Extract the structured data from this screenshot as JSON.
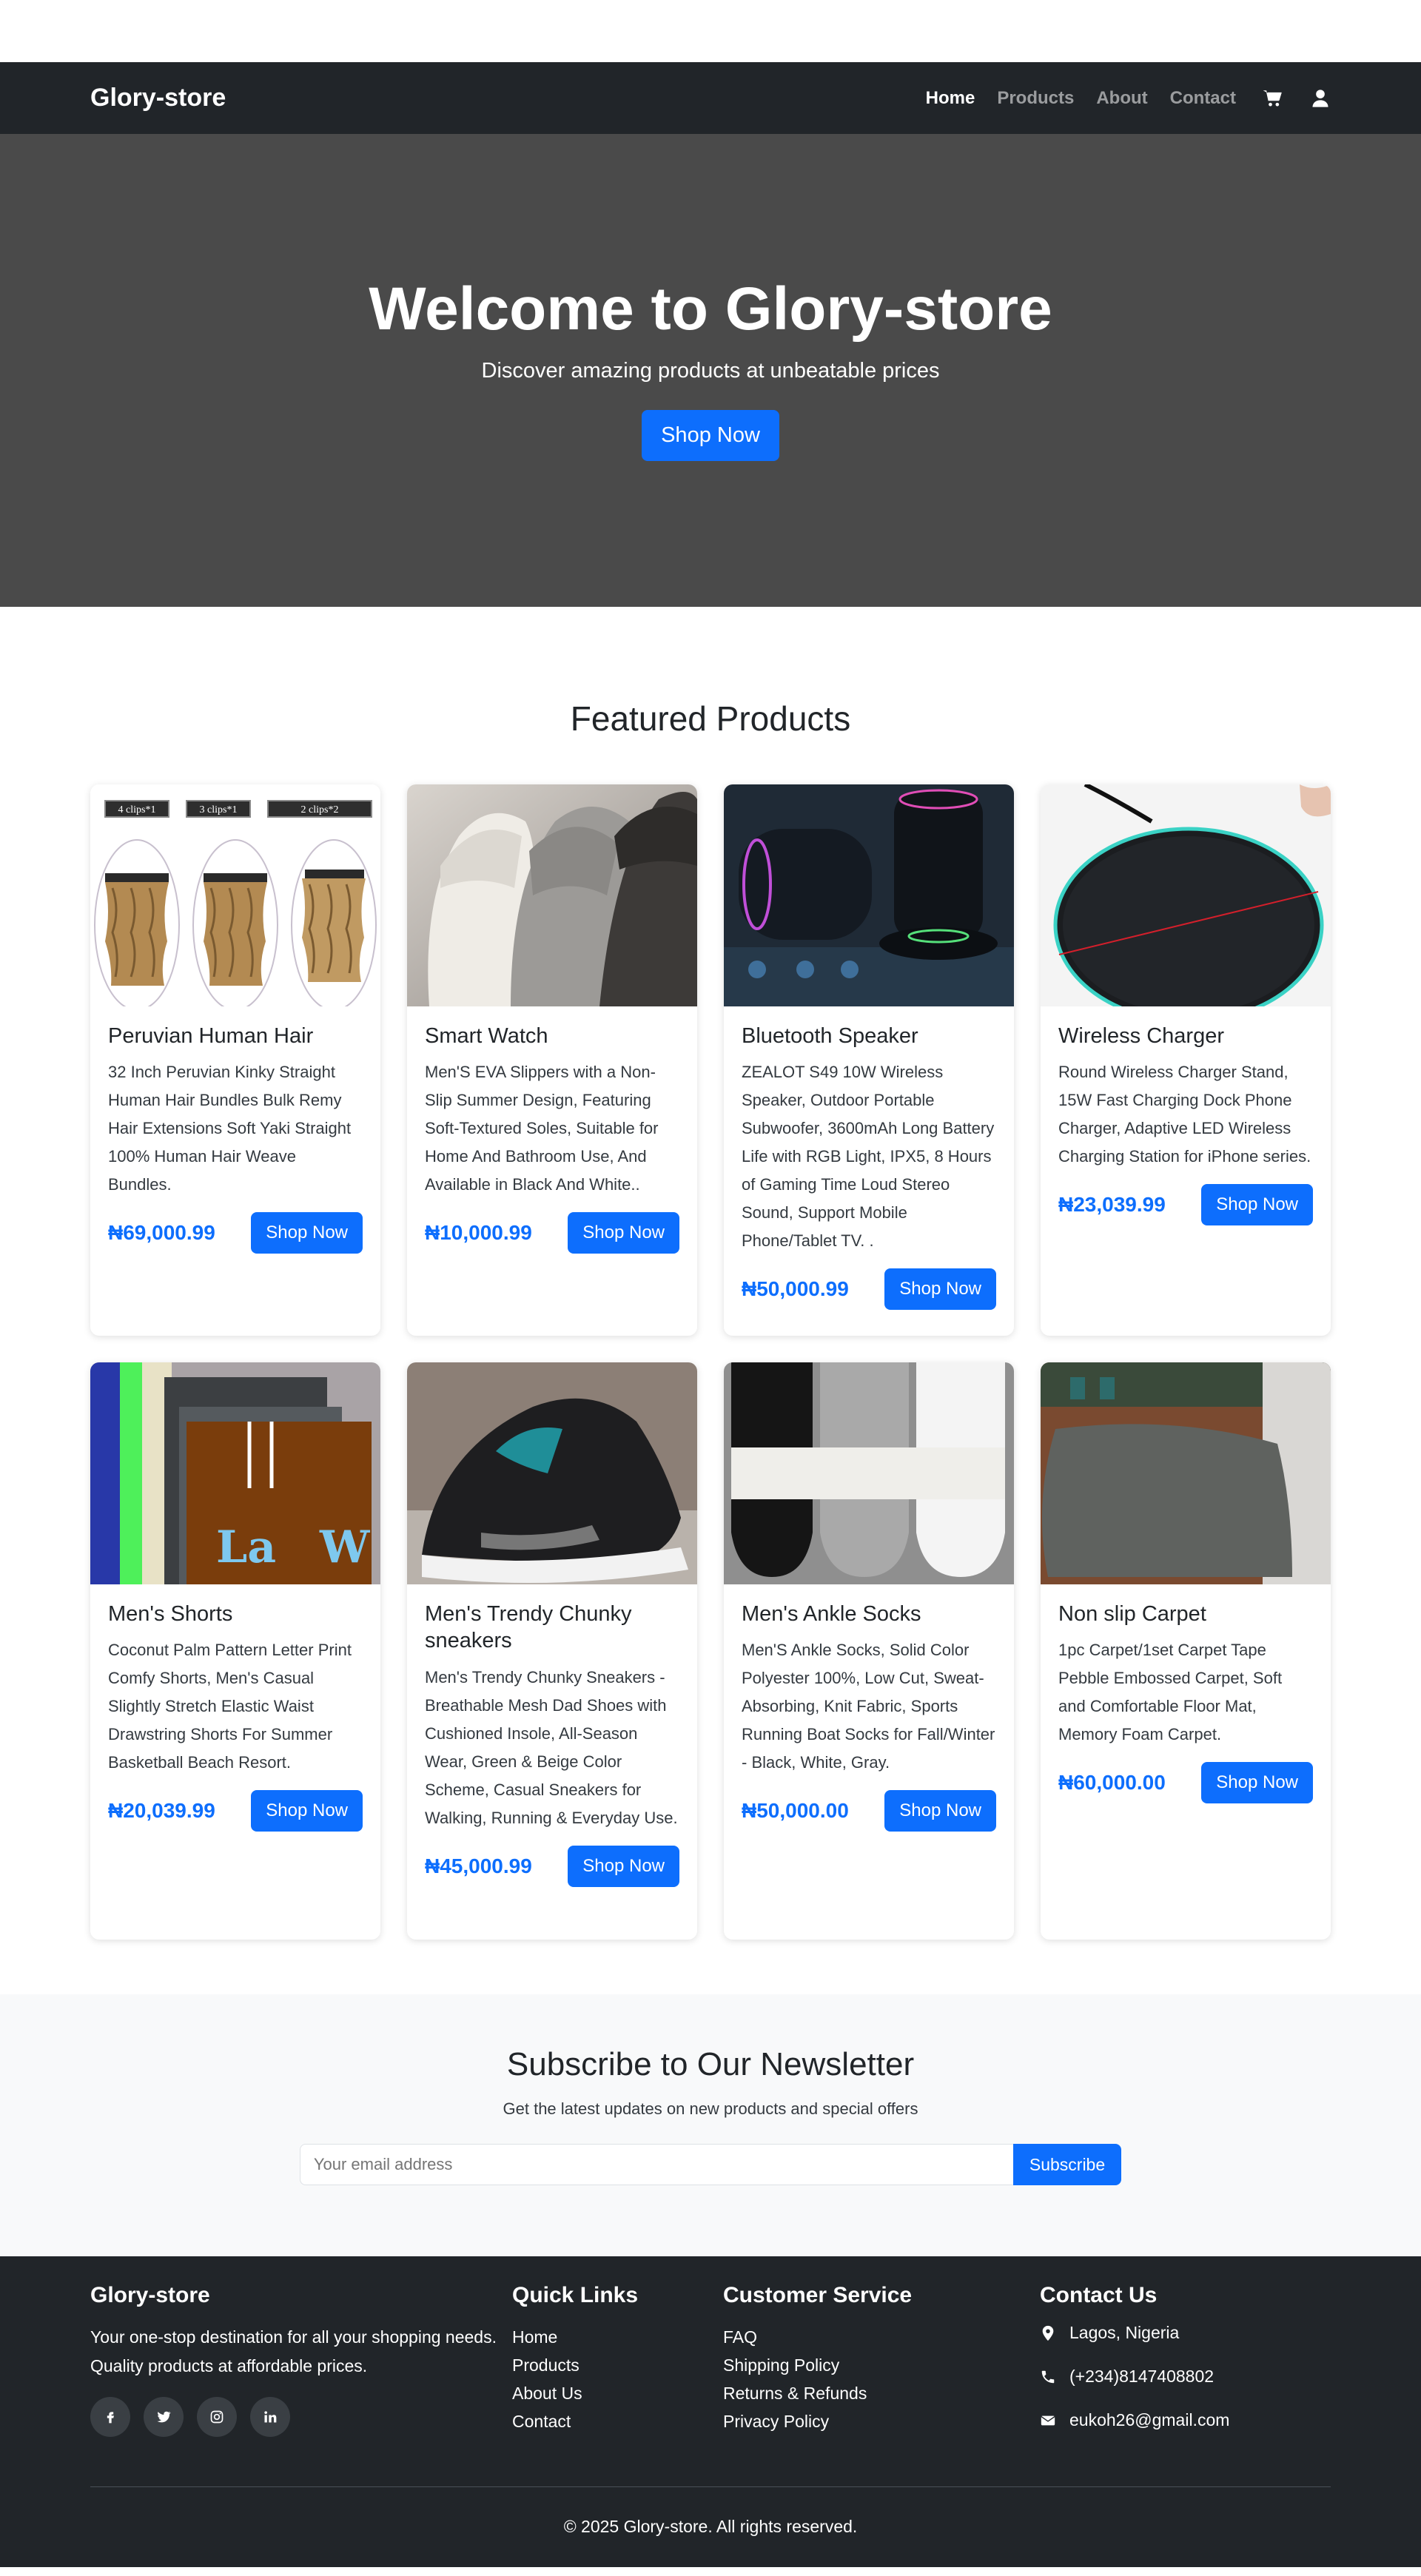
{
  "header": {
    "brand": "Glory-store",
    "nav": [
      "Home",
      "Products",
      "About",
      "Contact"
    ],
    "icons": [
      "cart-icon",
      "user-icon"
    ]
  },
  "hero": {
    "title": "Welcome to Glory-store",
    "subtitle": "Discover amazing products at unbeatable prices",
    "cta": "Shop Now"
  },
  "featured": {
    "title": "Featured Products",
    "products": [
      {
        "name": "Peruvian Human Hair",
        "description": "32 Inch Peruvian Kinky Straight Human Hair Bundles Bulk Remy Hair Extensions Soft Yaki Straight 100% Human Hair Weave Bundles.",
        "price": "₦69,000.99",
        "button": "Shop Now",
        "image_labels": [
          "4 clips*1",
          "3 clips*1",
          "2 clips*2"
        ]
      },
      {
        "name": "Smart Watch",
        "description": "Men'S EVA Slippers with a Non-Slip Summer Design, Featuring Soft-Textured Soles, Suitable for Home And Bathroom Use, And Available in Black And White..",
        "price": "₦10,000.99",
        "button": "Shop Now"
      },
      {
        "name": "Bluetooth Speaker",
        "description": "ZEALOT S49 10W Wireless Speaker, Outdoor Portable Subwoofer, 3600mAh Long Battery Life with RGB Light, IPX5, 8 Hours of Gaming Time Loud Stereo Sound, Support Mobile Phone/Tablet TV. .",
        "price": "₦50,000.99",
        "button": "Shop Now"
      },
      {
        "name": "Wireless Charger",
        "description": "Round Wireless Charger Stand, 15W Fast Charging Dock Phone Charger, Adaptive LED Wireless Charging Station for iPhone series.",
        "price": "₦23,039.99",
        "button": "Shop Now"
      },
      {
        "name": "Men's Shorts",
        "description": "Coconut Palm Pattern Letter Print Comfy Shorts, Men's Casual Slightly Stretch Elastic Waist Drawstring Shorts For Summer Basketball Beach Resort.",
        "price": "₦20,039.99",
        "button": "Shop Now"
      },
      {
        "name": "Men's Trendy Chunky sneakers",
        "description": "Men's Trendy Chunky Sneakers - Breathable Mesh Dad Shoes with Cushioned Insole, All-Season Wear, Green & Beige Color Scheme, Casual Sneakers for Walking, Running & Everyday Use.",
        "price": "₦45,000.99",
        "button": "Shop Now"
      },
      {
        "name": "Men's Ankle Socks",
        "description": "Men'S Ankle Socks, Solid Color Polyester 100%, Low Cut, Sweat-Absorbing, Knit Fabric, Sports Running Boat Socks for Fall/Winter - Black, White, Gray.",
        "price": "₦50,000.00",
        "button": "Shop Now"
      },
      {
        "name": "Non slip Carpet",
        "description": "1pc Carpet/1set Carpet Tape Pebble Embossed Carpet, Soft and Comfortable Floor Mat, Memory Foam Carpet.",
        "price": "₦60,000.00",
        "button": "Shop Now"
      }
    ]
  },
  "newsletter": {
    "title": "Subscribe to Our Newsletter",
    "subtitle": "Get the latest updates on new products and special offers",
    "placeholder": "Your email address",
    "button": "Subscribe"
  },
  "footer": {
    "brand": "Glory-store",
    "about": "Your one-stop destination for all your shopping needs. Quality products at affordable prices.",
    "socials": [
      "facebook-icon",
      "twitter-icon",
      "instagram-icon",
      "linkedin-icon"
    ],
    "quick_links_title": "Quick Links",
    "quick_links": [
      "Home",
      "Products",
      "About Us",
      "Contact"
    ],
    "service_title": "Customer Service",
    "service_links": [
      "FAQ",
      "Shipping Policy",
      "Returns & Refunds",
      "Privacy Policy"
    ],
    "contact_title": "Contact Us",
    "location": "Lagos, Nigeria",
    "phone": "(+234)8147408802",
    "email": "eukoh26@gmail.com",
    "copyright": "© 2025 Glory-store. All rights reserved."
  },
  "colors": {
    "primary": "#0d6efd",
    "dark": "#212529",
    "hero_bg": "#4a4a4a",
    "light_bg": "#f8f9fa"
  }
}
